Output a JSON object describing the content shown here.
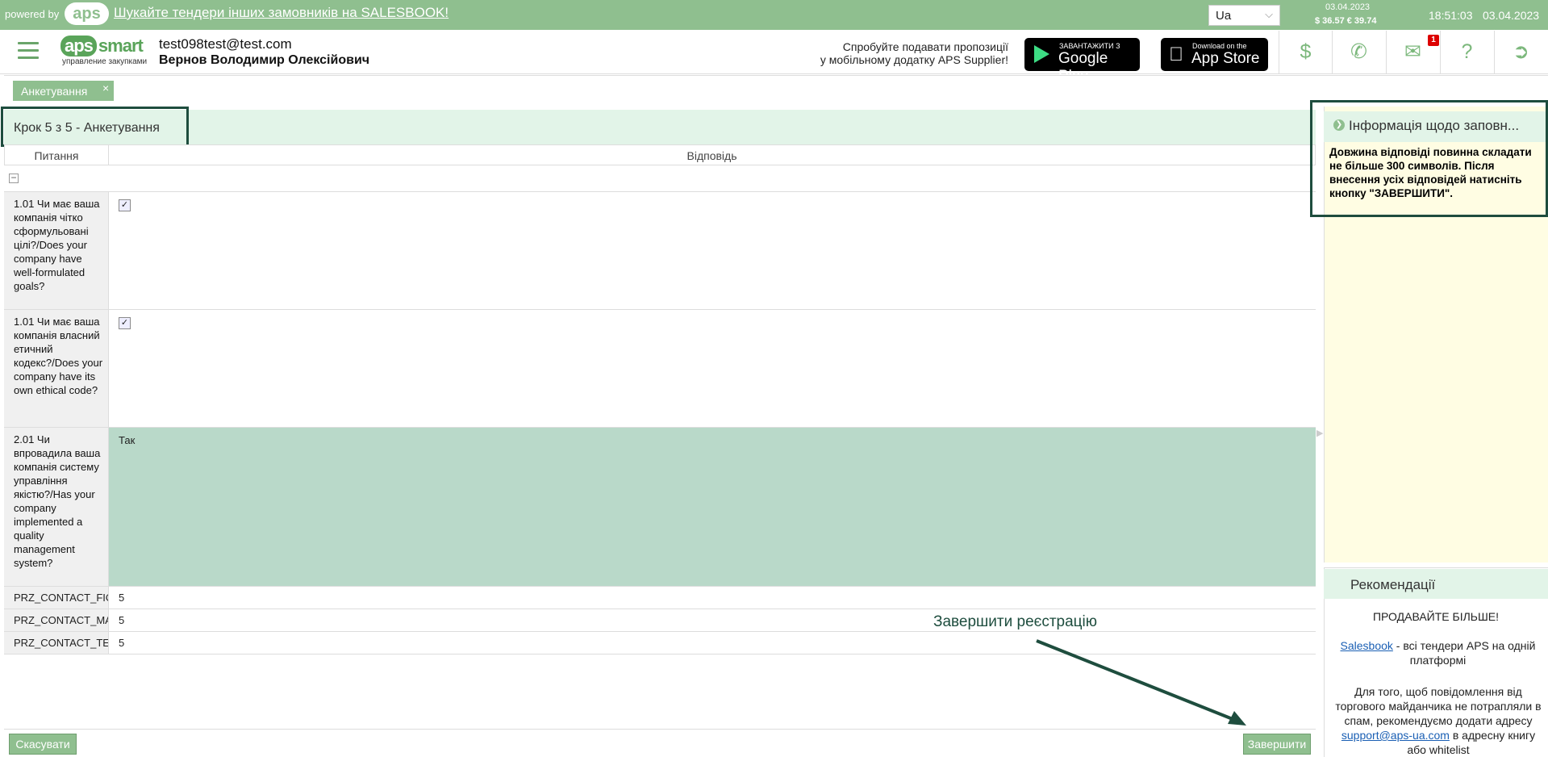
{
  "topbar": {
    "powered_by": "powered by",
    "aps_logo": "aps",
    "salesbook_link": "Шукайте тендери інших замовників на SALESBOOK!",
    "language": "Ua",
    "rate_date": "03.04.2023",
    "rates": "$ 36.57  € 39.74",
    "time": "18:51:03",
    "date": "03.04.2023"
  },
  "header": {
    "logo_main": "aps",
    "logo_word": "smart",
    "logo_sub": "управление закупками",
    "user_email": "test098test@test.com",
    "user_name": "Вернов Володимир Олексійович",
    "promo_line1": "Спробуйте подавати пропозиції",
    "promo_line2": "у мобільному додатку APS Supplier!",
    "gplay_small": "ЗАВАНТАЖИТИ З",
    "gplay_big": "Google Play",
    "appstore_small": "Download on the",
    "appstore_big": "App Store",
    "mail_badge": "1",
    "icons": [
      "dollar-icon",
      "phone-icon",
      "mail-icon",
      "help-icon",
      "logout-icon"
    ]
  },
  "tabs": [
    {
      "label": "Анкетування",
      "close": "×"
    }
  ],
  "step": {
    "title": "Крок 5 з 5 - Анкетування"
  },
  "table": {
    "col_question": "Питання",
    "col_answer": "Відповідь",
    "group_toggle": "−",
    "rows": [
      {
        "question": "1.01 Чи має ваша компанія чітко сформульовані цілі?/Does your company have well-formulated goals?",
        "answer_type": "checkbox",
        "checked": true
      },
      {
        "question": "1.01 Чи має ваша компанія власний етичний кодекс?/Does your company have its own ethical code?",
        "answer_type": "checkbox",
        "checked": true
      },
      {
        "question": "2.01 Чи впровадила ваша компанія систему управління якістю?/Has your company implemented a quality management system?",
        "answer": "Так"
      }
    ],
    "contact_rows": [
      {
        "question": "PRZ_CONTACT_FIO",
        "answer": "5"
      },
      {
        "question": "PRZ_CONTACT_MAIL",
        "answer": "5"
      },
      {
        "question": "PRZ_CONTACT_TEL",
        "answer": "5"
      }
    ]
  },
  "annotation": "Завершити реєстрацію",
  "buttons": {
    "cancel": "Скасувати",
    "finish": "Завершити"
  },
  "info_panel": {
    "title": "Інформація щодо заповн...",
    "text": "Довжина відповіді повинна складати не більше 300 символів. Після внесення усіх відповідей натисніть кнопку \"ЗАВЕРШИТИ\"."
  },
  "recommendations": {
    "title": "Рекомендації",
    "heading": "ПРОДАВАЙТЕ БІЛЬШЕ!",
    "p1_link": "Salesbook",
    "p1_text": " - всі тендери APS на одній платформі",
    "p2_text_a": "Для того, щоб повідомлення від торгового майданчика не потрапляли в спам, рекомендуємо додати адресу ",
    "p2_link": "support@aps-ua.com",
    "p2_text_b": " в адресну книгу або whitelist"
  },
  "colors": {
    "accent": "#8fbf8f",
    "highlight_row": "#b9d9c9",
    "outline": "#1e4d3e",
    "info_bg": "#fffde3"
  }
}
